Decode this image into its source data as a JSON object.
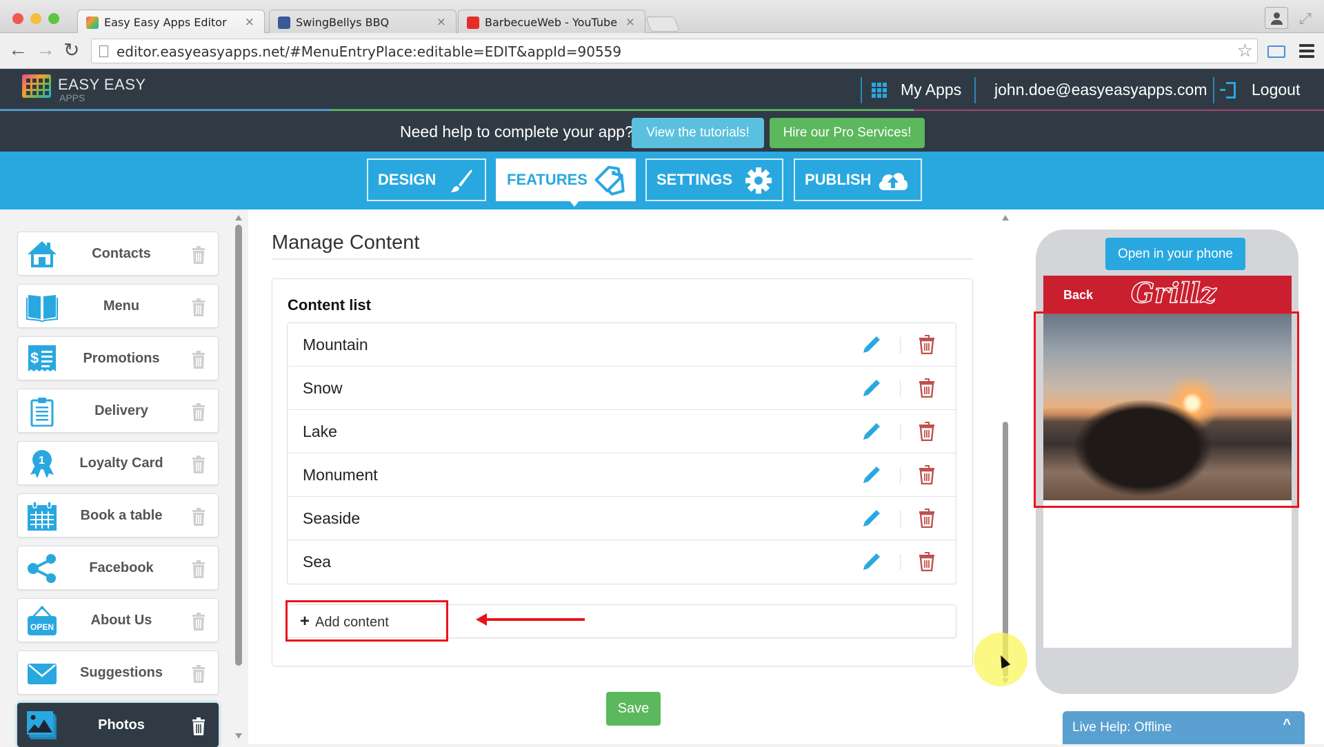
{
  "browser": {
    "tabs": [
      {
        "title": "Easy Easy Apps Editor",
        "icon": "easyeasyapps-favicon",
        "active": true
      },
      {
        "title": "SwingBellys BBQ",
        "icon": "facebook-favicon",
        "active": false
      },
      {
        "title": "BarbecueWeb - YouTube",
        "icon": "youtube-favicon",
        "active": false
      }
    ],
    "close_glyph": "×",
    "url": "editor.easyeasyapps.net/#MenuEntryPlace:editable=EDIT&appId=90559",
    "back_glyph": "←",
    "forward_glyph": "→",
    "reload_glyph": "↻",
    "star_glyph": "☆",
    "fullscreen_glyph": "⤢"
  },
  "header": {
    "brand_name": "EASY EASY",
    "brand_sub": "APPS",
    "my_apps": "My Apps",
    "user_email": "john.doe@easyeasyapps.com",
    "logout": "Logout"
  },
  "help_bar": {
    "text": "Need help to complete your app?",
    "tutorials_button": "View the tutorials!",
    "pro_button": "Hire our Pro Services!"
  },
  "nav_tabs": [
    {
      "label": "DESIGN",
      "icon": "paintbrush-icon",
      "active": false
    },
    {
      "label": "FEATURES",
      "icon": "tags-icon",
      "active": true
    },
    {
      "label": "SETTINGS",
      "icon": "gear-icon",
      "active": false
    },
    {
      "label": "PUBLISH",
      "icon": "cloud-upload-icon",
      "active": false
    }
  ],
  "sidebar": {
    "items": [
      {
        "label": "Contacts",
        "icon": "home-icon"
      },
      {
        "label": "Menu",
        "icon": "book-icon"
      },
      {
        "label": "Promotions",
        "icon": "receipt-icon"
      },
      {
        "label": "Delivery",
        "icon": "clipboard-icon"
      },
      {
        "label": "Loyalty Card",
        "icon": "award-ribbon-icon"
      },
      {
        "label": "Book a table",
        "icon": "calendar-icon"
      },
      {
        "label": "Facebook",
        "icon": "share-icon"
      },
      {
        "label": "About Us",
        "icon": "open-sign-icon"
      },
      {
        "label": "Suggestions",
        "icon": "envelope-icon"
      },
      {
        "label": "Photos",
        "icon": "photos-icon",
        "active": true
      }
    ],
    "open_sign_text": "OPEN",
    "award_number": "1",
    "promo_symbol": "$"
  },
  "main": {
    "title": "Manage Content",
    "list_title": "Content list",
    "items": [
      "Mountain",
      "Snow",
      "Lake",
      "Monument",
      "Seaside",
      "Sea"
    ],
    "add_label": "Add content",
    "add_glyph": "+",
    "save_label": "Save"
  },
  "preview": {
    "open_button": "Open in your phone",
    "back_label": "Back",
    "app_logo": "Grillz"
  },
  "live_help": {
    "label": "Live Help: Offline",
    "chevron": "^"
  },
  "colors": {
    "header_dark": "#2f3a45",
    "accent_blue": "#29a8e0",
    "success_green": "#5cb85c",
    "info_blue": "#5bc0de",
    "phone_header_red": "#c91f2e",
    "delete_red": "#c0504d",
    "annotation_red": "#e8141b"
  }
}
